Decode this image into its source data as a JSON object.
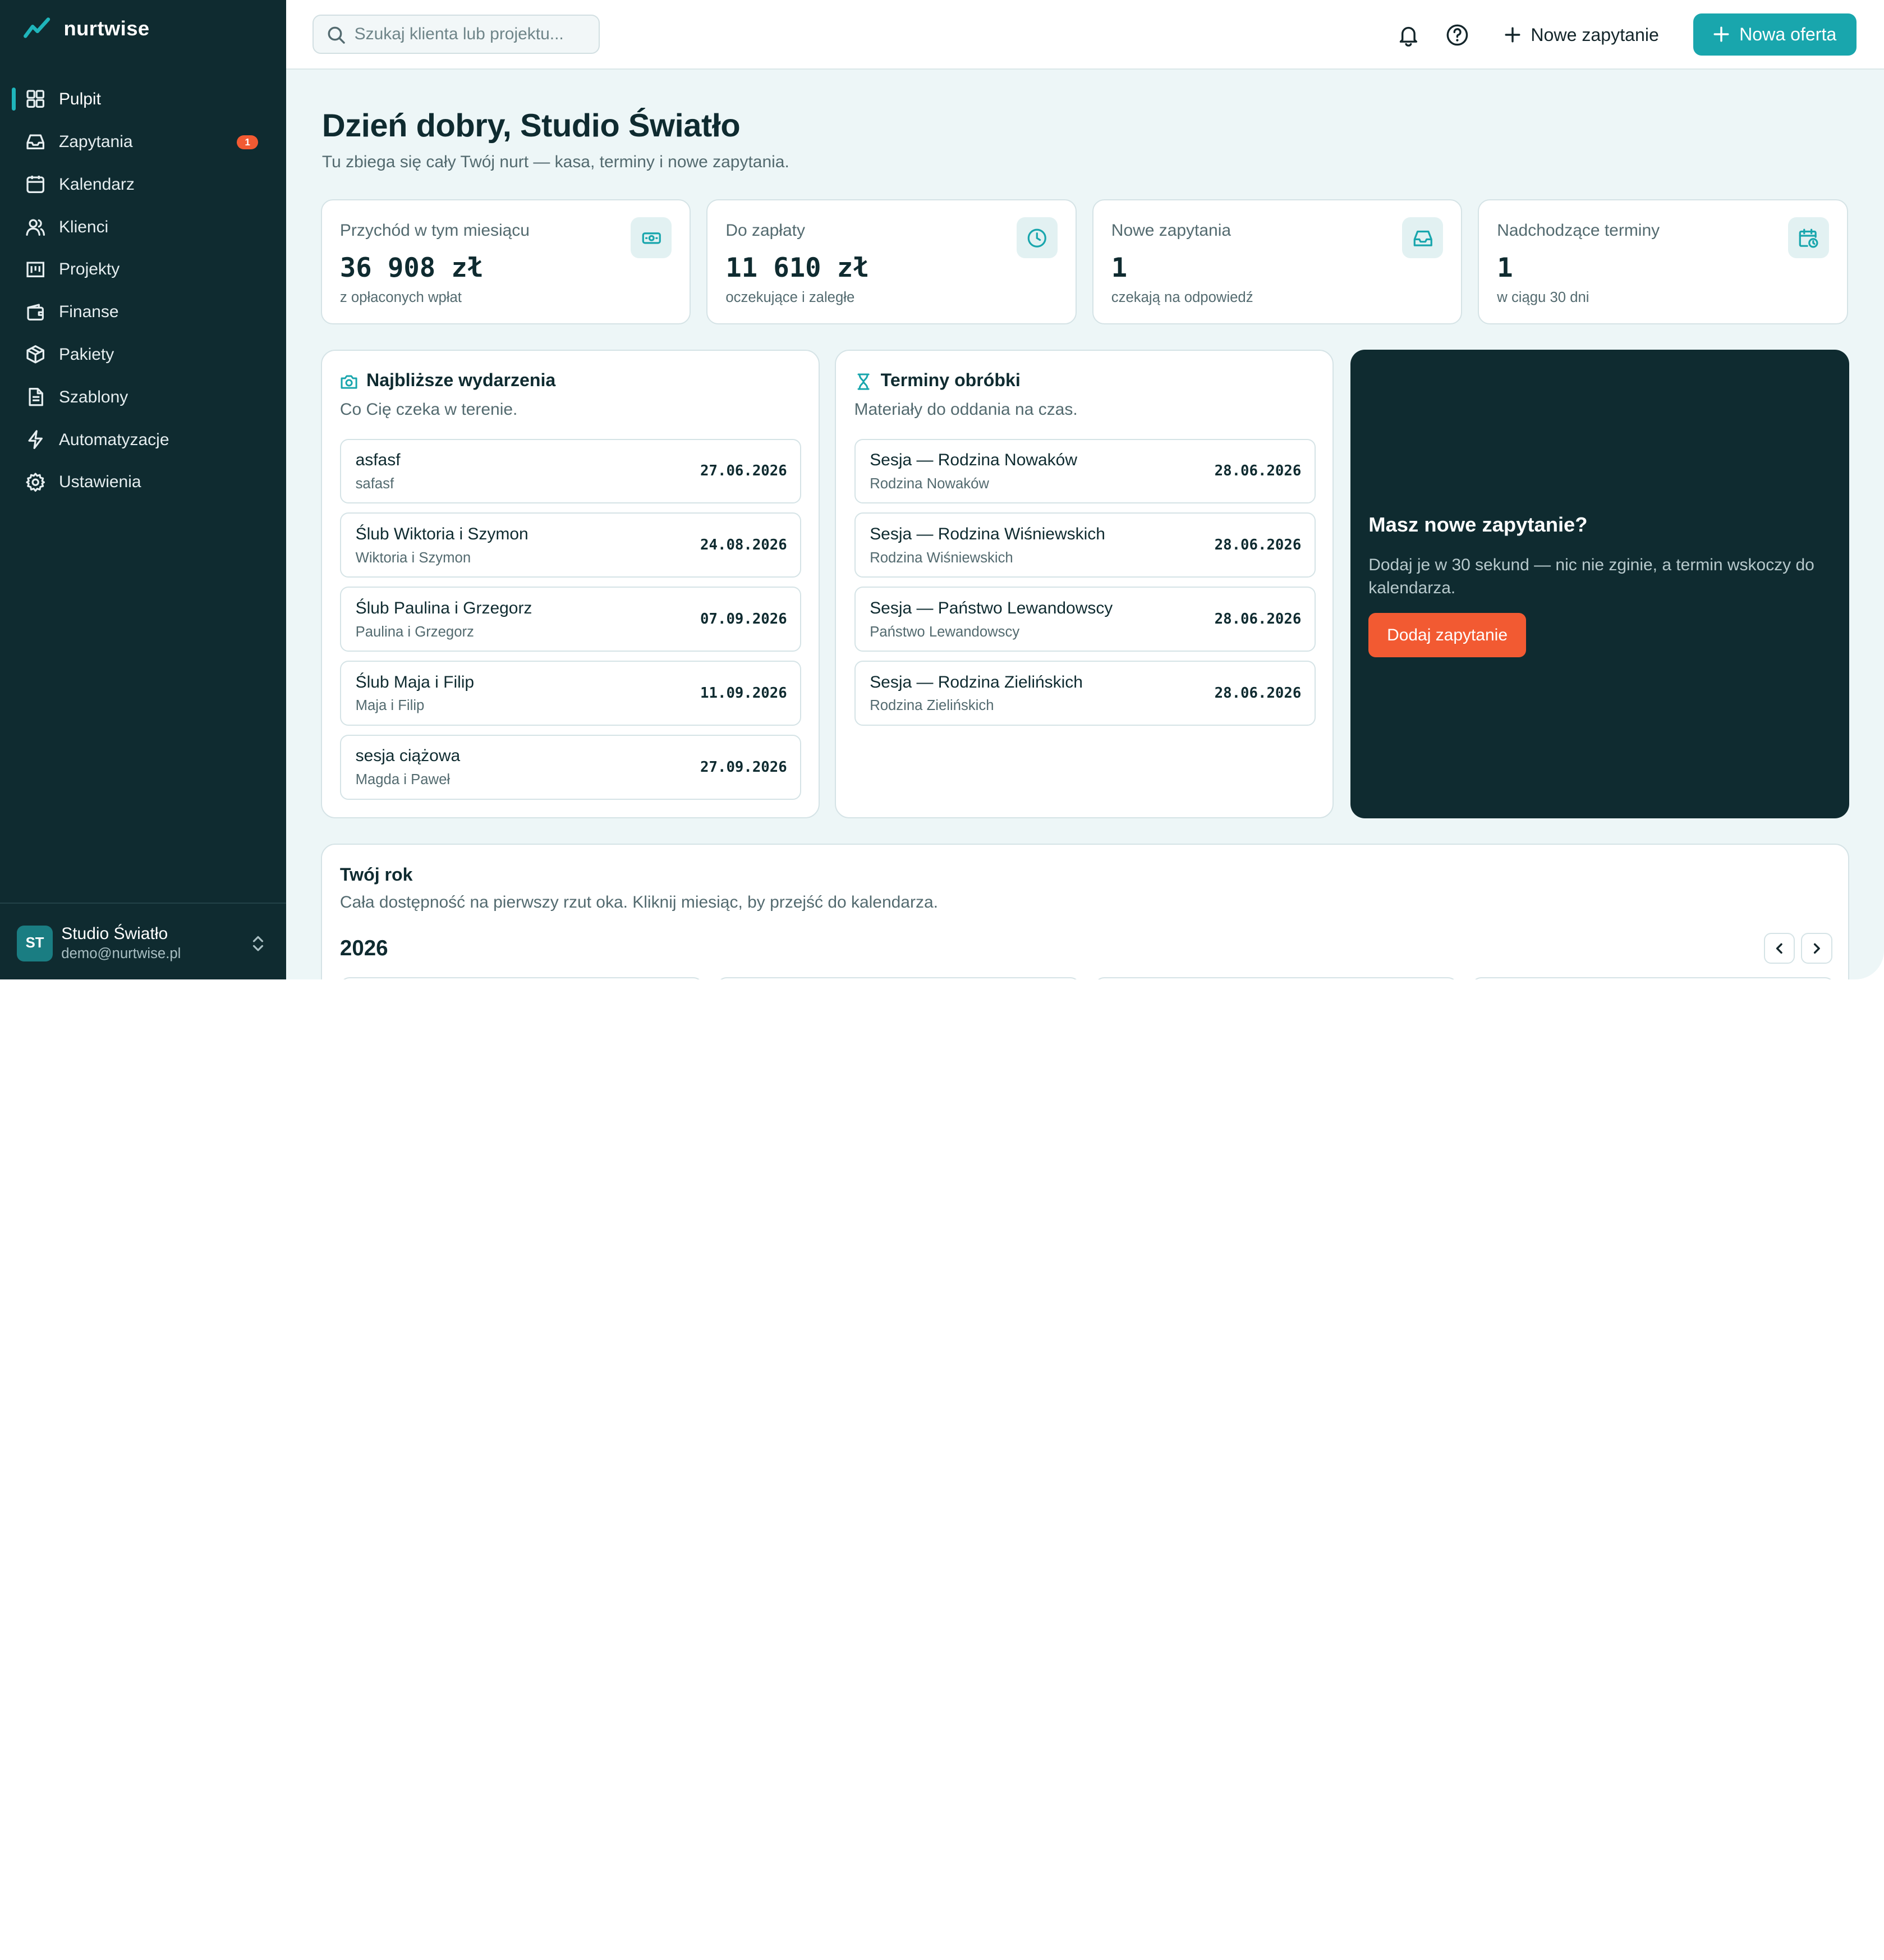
{
  "app": {
    "brand_name": "nurtwise",
    "accent_color": "#19a6ad",
    "sidebar_color": "#0f2b30",
    "highlight_color": "#f25a32"
  },
  "sidebar": {
    "items": [
      {
        "label": "Pulpit",
        "icon": "dashboard-icon",
        "active": true
      },
      {
        "label": "Zapytania",
        "icon": "inbox-icon",
        "badge": "1"
      },
      {
        "label": "Kalendarz",
        "icon": "calendar-icon"
      },
      {
        "label": "Klienci",
        "icon": "users-icon"
      },
      {
        "label": "Projekty",
        "icon": "projects-icon"
      },
      {
        "label": "Finanse",
        "icon": "wallet-icon"
      },
      {
        "label": "Pakiety",
        "icon": "package-icon"
      },
      {
        "label": "Szablony",
        "icon": "file-icon"
      },
      {
        "label": "Automatyzacje",
        "icon": "bolt-icon"
      },
      {
        "label": "Ustawienia",
        "icon": "gear-icon"
      }
    ],
    "user": {
      "initials": "ST",
      "name": "Studio Światło",
      "email": "demo@nurtwise.pl"
    }
  },
  "topbar": {
    "search_placeholder": "Szukaj klienta lub projektu...",
    "new_inquiry_label": "Nowe zapytanie",
    "new_offer_label": "Nowa oferta"
  },
  "main": {
    "greeting": "Dzień dobry, Studio Światło",
    "subtitle": "Tu zbiega się cały Twój nurt — kasa, terminy i nowe zapytania.",
    "stats": [
      {
        "label": "Przychód w tym miesiącu",
        "value": "36 908 zł",
        "sub": "z opłaconych wpłat",
        "icon": "money-icon"
      },
      {
        "label": "Do zapłaty",
        "value": "11 610 zł",
        "sub": "oczekujące i zaległe",
        "icon": "clock-icon"
      },
      {
        "label": "Nowe zapytania",
        "value": "1",
        "sub": "czekają na odpowiedź",
        "icon": "inbox-icon"
      },
      {
        "label": "Nadchodzące terminy",
        "value": "1",
        "sub": "w ciągu 30 dni",
        "icon": "calendar-clock-icon"
      }
    ],
    "events": {
      "title": "Najbliższe wydarzenia",
      "subtitle": "Co Cię czeka w terenie.",
      "items": [
        {
          "title": "asfasf",
          "sub": "safasf",
          "date": "27.06.2026"
        },
        {
          "title": "Ślub Wiktoria i Szymon",
          "sub": "Wiktoria i Szymon",
          "date": "24.08.2026"
        },
        {
          "title": "Ślub Paulina i Grzegorz",
          "sub": "Paulina i Grzegorz",
          "date": "07.09.2026"
        },
        {
          "title": "Ślub Maja i Filip",
          "sub": "Maja i Filip",
          "date": "11.09.2026"
        },
        {
          "title": "sesja ciążowa",
          "sub": "Magda i Paweł",
          "date": "27.09.2026"
        }
      ]
    },
    "deadlines": {
      "title": "Terminy obróbki",
      "subtitle": "Materiały do oddania na czas.",
      "items": [
        {
          "title": "Sesja — Rodzina Nowaków",
          "sub": "Rodzina Nowaków",
          "date": "28.06.2026"
        },
        {
          "title": "Sesja — Rodzina Wiśniewskich",
          "sub": "Rodzina Wiśniewskich",
          "date": "28.06.2026"
        },
        {
          "title": "Sesja — Państwo Lewandowscy",
          "sub": "Państwo Lewandowscy",
          "date": "28.06.2026"
        },
        {
          "title": "Sesja — Rodzina Zielińskich",
          "sub": "Rodzina Zielińskich",
          "date": "28.06.2026"
        }
      ]
    },
    "cta": {
      "title": "Masz nowe zapytanie?",
      "text": "Dodaj je w 30 sekund — nic nie zginie, a termin wskoczy do kalendarza.",
      "button": "Dodaj zapytanie"
    },
    "year": {
      "title": "Twój rok",
      "subtitle": "Cała dostępność na pierwszy rzut oka. Kliknij miesiąc, by przejść do kalendarza.",
      "year": "2026"
    }
  }
}
